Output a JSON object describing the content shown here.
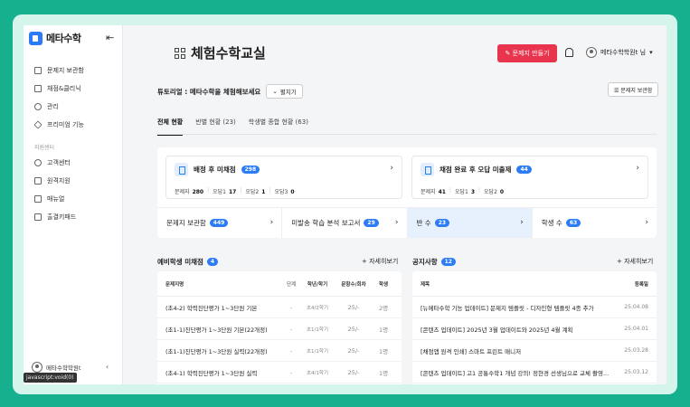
{
  "sidebar": {
    "logo_text": "메타수학",
    "collapse_glyph": "⇤",
    "items": [
      {
        "label": "문제지 보관함",
        "icon": "document-icon"
      },
      {
        "label": "채점&클리닉",
        "icon": "checklist-icon"
      },
      {
        "label": "관리",
        "icon": "users-icon"
      },
      {
        "label": "프리미엄 기능",
        "icon": "diamond-icon"
      }
    ],
    "support_title": "지원센터",
    "support_items": [
      {
        "label": "고객센터",
        "icon": "headset-icon"
      },
      {
        "label": "원격지원",
        "icon": "remote-icon"
      },
      {
        "label": "매뉴얼",
        "icon": "book-icon"
      },
      {
        "label": "출결키패드",
        "icon": "calendar-icon"
      }
    ],
    "user_name": "메타수학학원t",
    "user_chevron": "‹",
    "status_url": "javascript:void(0)"
  },
  "header": {
    "title": "체험수학교실",
    "make_button": "✎ 문제지 만들기",
    "user_label": "메타수학학원t 님",
    "user_caret": "▾"
  },
  "tutorial": {
    "text": "튜토리얼 : 메타수학을 체험해보세요",
    "fold_label": "펼치기",
    "fold_caret": "⌄",
    "library_button": "☰ 문제지 보관함"
  },
  "tabs": [
    {
      "label": "전체 현황",
      "active": true
    },
    {
      "label": "반별 현황 (23)",
      "active": false
    },
    {
      "label": "학생별 종합 현황 (63)",
      "active": false
    }
  ],
  "cards": [
    {
      "title": "배정 후 미채점",
      "badge": "298",
      "stats": [
        {
          "label": "문제지",
          "value": "280"
        },
        {
          "label": "오답1",
          "value": "17"
        },
        {
          "label": "오답2",
          "value": "1"
        },
        {
          "label": "오답3",
          "value": "0"
        }
      ]
    },
    {
      "title": "채점 완료 후 오답 미출제",
      "badge": "44",
      "stats": [
        {
          "label": "문제지",
          "value": "41"
        },
        {
          "label": "오답1",
          "value": "3"
        },
        {
          "label": "오답2",
          "value": "0"
        }
      ]
    }
  ],
  "mini_cards": [
    {
      "label": "문제지 보관함",
      "badge": "449"
    },
    {
      "label": "미발송 학습 분석 보고서",
      "badge": "29"
    },
    {
      "label": "반 수",
      "badge": "23"
    },
    {
      "label": "학생 수",
      "badge": "63"
    }
  ],
  "chevron": "›",
  "pending": {
    "title": "예비학생 미채점",
    "badge": "4",
    "more": "+ 자세히보기",
    "columns": [
      "문제지명",
      "단계",
      "학년/학기",
      "문항수/회차",
      "학생"
    ],
    "rows": [
      [
        "(초4-2) 학력진단평가 1~3단원 기본",
        "-",
        "초4/2학기",
        "25/-",
        "2명"
      ],
      [
        "(초1-1)진단평가 1~3단원 기본(22개정)",
        "-",
        "초1/1학기",
        "25/-",
        "1명"
      ],
      [
        "(초1-1)진단평가 1~3단원 실력(22개정)",
        "-",
        "초1/1학기",
        "25/-",
        "1명"
      ],
      [
        "(초4-1) 학력진단평가 1~3단원 실력",
        "-",
        "초4/1학기",
        "25/-",
        "1명"
      ]
    ]
  },
  "notice": {
    "title": "공지사항",
    "badge": "12",
    "more": "+ 자세히보기",
    "columns": [
      "제목",
      "등록일"
    ],
    "rows": [
      [
        "[뉴메타수학 기능 업데이트] 문제지 템플릿 - 디자인형 템플릿 4종 추가",
        "25.04.08"
      ],
      [
        "[콘텐츠 업데이트] 2025년 3월 업데이트와 2025년 4월 계획",
        "25.04.01"
      ],
      [
        "[채점앱 원격 인쇄] 스마트 프린트 매니저",
        "25.03.28"
      ],
      [
        "[콘텐츠 업데이트] 고1 공통수학1 개념 강의! 정현경 선생님으로 교체 촬영...",
        "25.03.12"
      ]
    ]
  },
  "colors": {
    "accent": "#2b7cf6",
    "brand_red": "#e8344d",
    "frame_green": "#16b08f"
  }
}
